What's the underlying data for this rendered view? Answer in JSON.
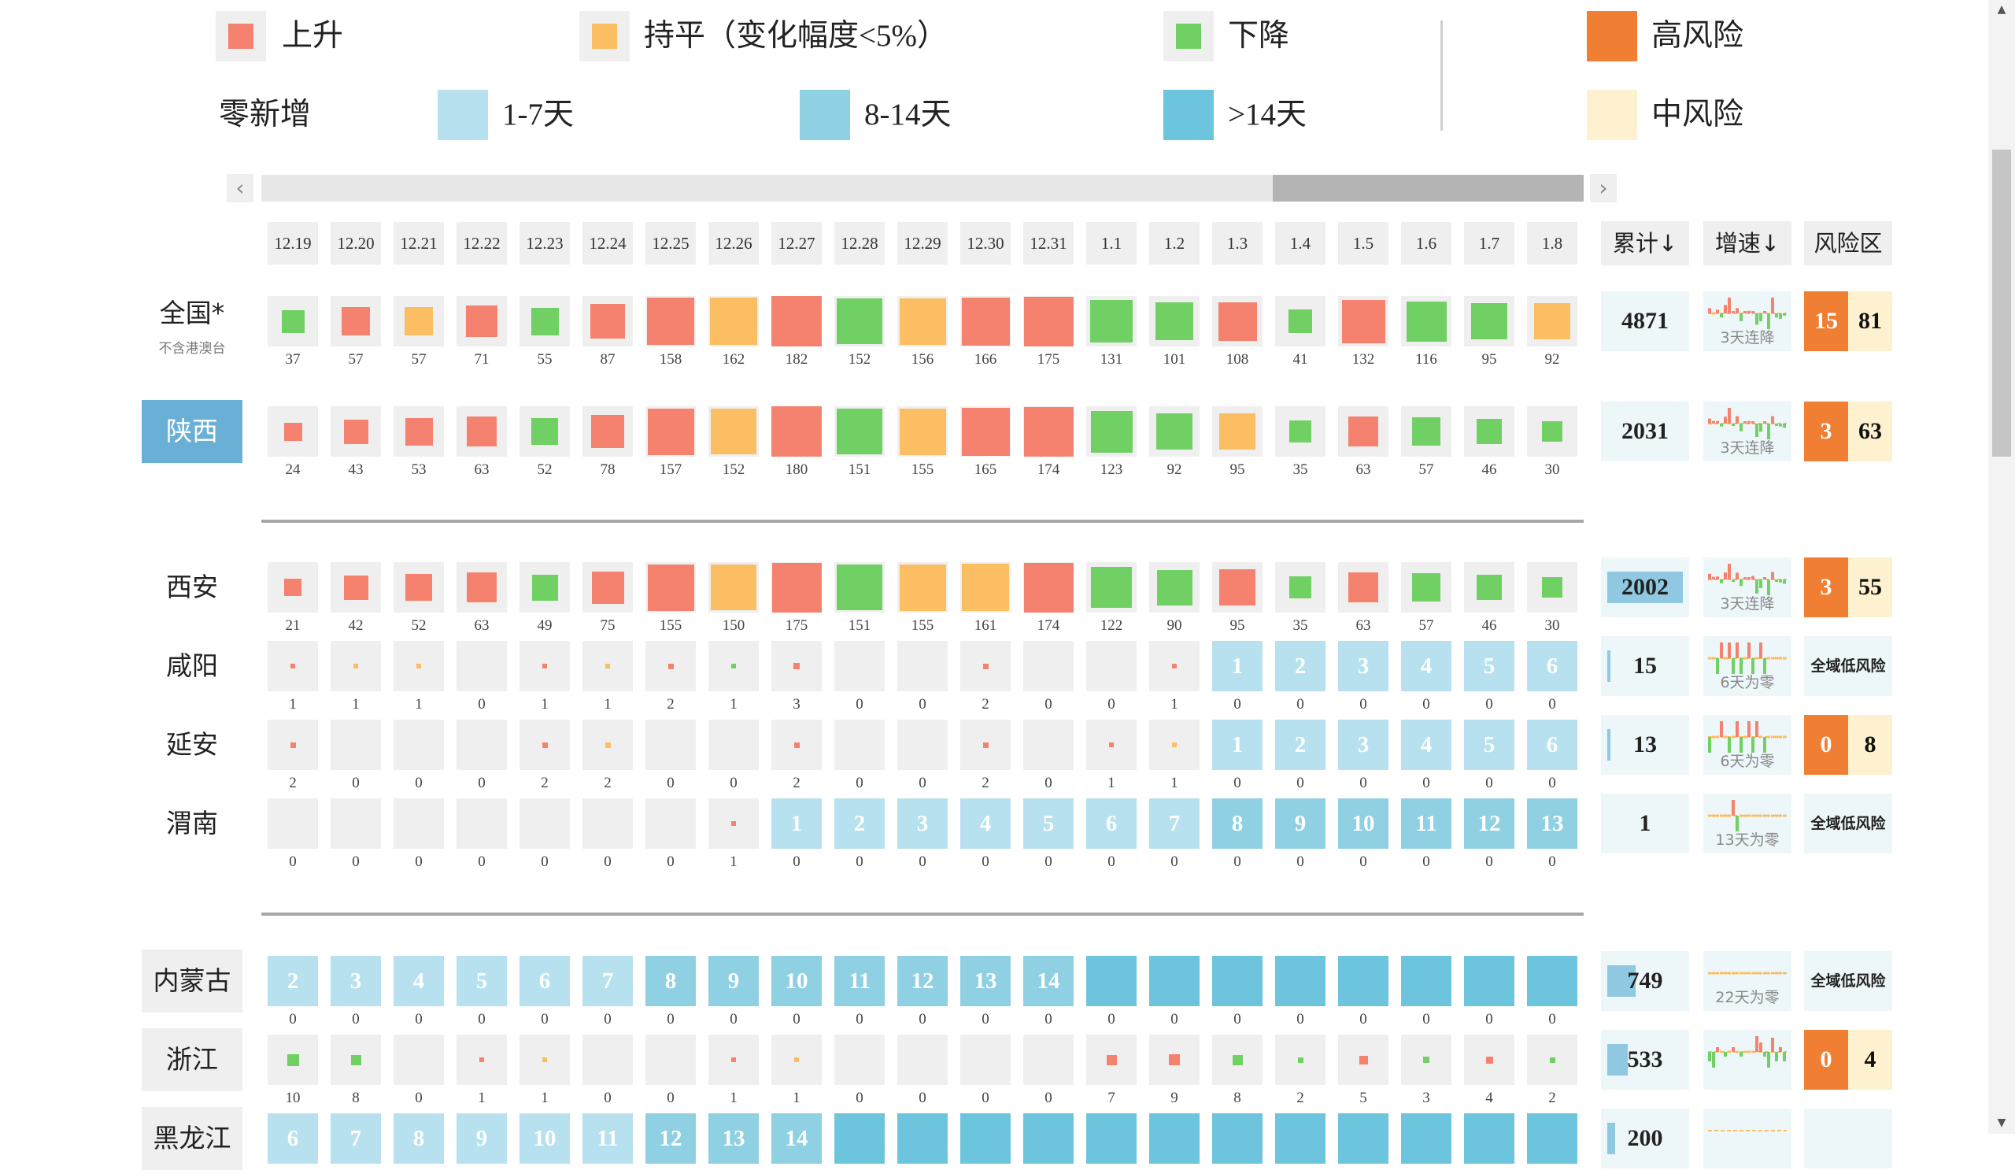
{
  "legend": {
    "rise": {
      "label": "上升",
      "color": "#f4826e"
    },
    "flat": {
      "label": "持平（变化幅度<5%）",
      "color": "#fbbe63"
    },
    "fall": {
      "label": "下降",
      "color": "#70d063"
    },
    "zero_label": "零新增",
    "d1_7": {
      "label": "1-7天",
      "color": "#b7e1ee"
    },
    "d8_14": {
      "label": "8-14天",
      "color": "#8fd0e2"
    },
    "d14": {
      "label": ">14天",
      "color": "#6cc5dc"
    },
    "high_risk": {
      "label": "高风险",
      "color": "#f07e33"
    },
    "mid_risk": {
      "label": "中风险",
      "color": "#fdf1cf"
    }
  },
  "table": {
    "dates": [
      "12.19",
      "12.20",
      "12.21",
      "12.22",
      "12.23",
      "12.24",
      "12.25",
      "12.26",
      "12.27",
      "12.28",
      "12.29",
      "12.30",
      "12.31",
      "1.1",
      "1.2",
      "1.3",
      "1.4",
      "1.5",
      "1.6",
      "1.7",
      "1.8"
    ],
    "col_total": "累计↓",
    "col_speed": "增速↓",
    "col_risk": "风险区",
    "scroll_left_icon": "chevron-left-icon",
    "scroll_right_icon": "chevron-right-icon",
    "scroll_thumb_fraction": 0.235,
    "scroll_position_fraction": 1.0
  },
  "rows": [
    {
      "name": "全国*",
      "sub": "不含港澳台",
      "style": "plain",
      "cells": [
        "f",
        "r",
        "s",
        "r",
        "f",
        "r",
        "r",
        "s",
        "r",
        "f",
        "s",
        "r",
        "r",
        "f",
        "f",
        "r",
        "f",
        "r",
        "f",
        "f",
        "s"
      ],
      "values": [
        37,
        57,
        57,
        71,
        55,
        87,
        158,
        162,
        182,
        152,
        156,
        166,
        175,
        131,
        101,
        108,
        41,
        132,
        116,
        95,
        92
      ],
      "total": "4871",
      "total_bar": 0,
      "trend_label": "3天连降",
      "spark": [
        37,
        57,
        57,
        71,
        55,
        87,
        158,
        162,
        182,
        152,
        156,
        166,
        175,
        131,
        101,
        108,
        41,
        132,
        116,
        95,
        92
      ],
      "risk_high": "15",
      "risk_mid": "81",
      "risk_low": ""
    },
    {
      "name": "陕西",
      "sub": "",
      "style": "highlight",
      "cells": [
        "r",
        "r",
        "r",
        "r",
        "f",
        "r",
        "r",
        "s",
        "r",
        "f",
        "s",
        "r",
        "r",
        "f",
        "f",
        "s",
        "f",
        "r",
        "f",
        "f",
        "f"
      ],
      "values": [
        24,
        43,
        53,
        63,
        52,
        78,
        157,
        152,
        180,
        151,
        155,
        165,
        174,
        123,
        92,
        95,
        35,
        63,
        57,
        46,
        30
      ],
      "total": "2031",
      "total_bar": 0,
      "trend_label": "3天连降",
      "spark": [
        24,
        43,
        53,
        63,
        52,
        78,
        157,
        152,
        180,
        151,
        155,
        165,
        174,
        123,
        92,
        95,
        35,
        63,
        57,
        46,
        30
      ],
      "risk_high": "3",
      "risk_mid": "63",
      "risk_low": ""
    },
    {
      "name": "西安",
      "sub": "",
      "style": "plain",
      "cells": [
        "r",
        "r",
        "r",
        "r",
        "f",
        "r",
        "r",
        "s",
        "r",
        "f",
        "s",
        "s",
        "r",
        "f",
        "f",
        "r",
        "f",
        "r",
        "f",
        "f",
        "f"
      ],
      "values": [
        21,
        42,
        52,
        63,
        49,
        75,
        155,
        150,
        175,
        151,
        155,
        161,
        174,
        122,
        90,
        95,
        35,
        63,
        57,
        46,
        30
      ],
      "total": "2002",
      "total_bar": 1.0,
      "trend_label": "3天连降",
      "spark": [
        21,
        42,
        52,
        63,
        49,
        75,
        155,
        150,
        175,
        151,
        155,
        161,
        174,
        122,
        90,
        95,
        35,
        63,
        57,
        46,
        30
      ],
      "risk_high": "3",
      "risk_mid": "55",
      "risk_low": ""
    },
    {
      "name": "咸阳",
      "sub": "",
      "style": "plain",
      "cells": [
        "r",
        "s",
        "s",
        "e",
        "r",
        "s",
        "r",
        "f",
        "r",
        "e",
        "e",
        "r",
        "e",
        "e",
        "r",
        "z1",
        "z1",
        "z1",
        "z1",
        "z1",
        "z1"
      ],
      "zero_days": [
        "",
        "",
        "",
        "",
        "",
        "",
        "",
        "",
        "",
        "",
        "",
        "",
        "",
        "",
        "",
        "1",
        "2",
        "3",
        "4",
        "5",
        "6"
      ],
      "values": [
        1,
        1,
        1,
        0,
        1,
        1,
        2,
        1,
        3,
        0,
        0,
        2,
        0,
        0,
        1,
        0,
        0,
        0,
        0,
        0,
        0
      ],
      "total": "15",
      "total_bar": 0.0075,
      "trend_label": "6天为零",
      "spark": [
        1,
        1,
        1,
        0,
        1,
        1,
        2,
        1,
        3,
        0,
        0,
        2,
        0,
        0,
        1,
        0,
        0,
        0,
        0,
        0,
        0
      ],
      "risk_high": "",
      "risk_mid": "",
      "risk_low": "全域低风险"
    },
    {
      "name": "延安",
      "sub": "",
      "style": "plain",
      "cells": [
        "r",
        "e",
        "e",
        "e",
        "r",
        "s",
        "e",
        "e",
        "r",
        "e",
        "e",
        "r",
        "e",
        "r",
        "s",
        "z1",
        "z1",
        "z1",
        "z1",
        "z1",
        "z1"
      ],
      "zero_days": [
        "",
        "",
        "",
        "",
        "",
        "",
        "",
        "",
        "",
        "",
        "",
        "",
        "",
        "",
        "",
        "1",
        "2",
        "3",
        "4",
        "5",
        "6"
      ],
      "values": [
        2,
        0,
        0,
        0,
        2,
        2,
        0,
        0,
        2,
        0,
        0,
        2,
        0,
        1,
        1,
        0,
        0,
        0,
        0,
        0,
        0
      ],
      "total": "13",
      "total_bar": 0.0065,
      "trend_label": "6天为零",
      "spark": [
        2,
        0,
        0,
        0,
        2,
        2,
        0,
        0,
        2,
        0,
        0,
        2,
        0,
        1,
        1,
        0,
        0,
        0,
        0,
        0,
        0
      ],
      "risk_high": "0",
      "risk_mid": "8",
      "risk_low": ""
    },
    {
      "name": "渭南",
      "sub": "",
      "style": "plain",
      "cells": [
        "e",
        "e",
        "e",
        "e",
        "e",
        "e",
        "e",
        "r",
        "z1",
        "z1",
        "z1",
        "z1",
        "z1",
        "z1",
        "z1",
        "z2",
        "z2",
        "z2",
        "z2",
        "z2",
        "z2"
      ],
      "zero_days": [
        "",
        "",
        "",
        "",
        "",
        "",
        "",
        "",
        "1",
        "2",
        "3",
        "4",
        "5",
        "6",
        "7",
        "8",
        "9",
        "10",
        "11",
        "12",
        "13"
      ],
      "values": [
        0,
        0,
        0,
        0,
        0,
        0,
        0,
        1,
        0,
        0,
        0,
        0,
        0,
        0,
        0,
        0,
        0,
        0,
        0,
        0,
        0
      ],
      "total": "1",
      "total_bar": 0,
      "trend_label": "13天为零",
      "spark": [
        0,
        0,
        0,
        0,
        0,
        0,
        0,
        1,
        0,
        0,
        0,
        0,
        0,
        0,
        0,
        0,
        0,
        0,
        0,
        0,
        0
      ],
      "risk_high": "",
      "risk_mid": "",
      "risk_low": "全域低风险"
    },
    {
      "name": "内蒙古",
      "sub": "",
      "style": "gray",
      "cells": [
        "z1",
        "z1",
        "z1",
        "z1",
        "z1",
        "z1",
        "z2",
        "z2",
        "z2",
        "z2",
        "z2",
        "z2",
        "z2",
        "z3",
        "z3",
        "z3",
        "z3",
        "z3",
        "z3",
        "z3",
        "z3"
      ],
      "zero_days": [
        "2",
        "3",
        "4",
        "5",
        "6",
        "7",
        "8",
        "9",
        "10",
        "11",
        "12",
        "13",
        "14",
        "",
        "",
        "",
        "",
        "",
        "",
        "",
        ""
      ],
      "values": [
        0,
        0,
        0,
        0,
        0,
        0,
        0,
        0,
        0,
        0,
        0,
        0,
        0,
        0,
        0,
        0,
        0,
        0,
        0,
        0,
        0
      ],
      "total": "749",
      "total_bar": 0.37,
      "trend_label": "22天为零",
      "spark": [
        0,
        0,
        0,
        0,
        0,
        0,
        0,
        0,
        0,
        0,
        0,
        0,
        0,
        0,
        0,
        0,
        0,
        0,
        0,
        0,
        0
      ],
      "risk_high": "",
      "risk_mid": "",
      "risk_low": "全域低风险"
    },
    {
      "name": "浙江",
      "sub": "",
      "style": "gray",
      "cells": [
        "f",
        "f",
        "e",
        "r",
        "s",
        "e",
        "e",
        "r",
        "s",
        "e",
        "e",
        "e",
        "e",
        "r",
        "r",
        "f",
        "f",
        "r",
        "f",
        "r",
        "f"
      ],
      "values": [
        10,
        8,
        0,
        1,
        1,
        0,
        0,
        1,
        1,
        0,
        0,
        0,
        0,
        7,
        9,
        8,
        2,
        5,
        3,
        4,
        2
      ],
      "total": "533",
      "total_bar": 0.27,
      "trend_label": "",
      "spark": [
        10,
        8,
        0,
        1,
        1,
        0,
        0,
        1,
        1,
        0,
        0,
        0,
        0,
        7,
        9,
        8,
        2,
        5,
        3,
        4,
        2
      ],
      "risk_high": "0",
      "risk_mid": "4",
      "risk_low": ""
    },
    {
      "name": "黑龙江",
      "sub": "",
      "style": "gray",
      "cells": [
        "z1",
        "z1",
        "z1",
        "z1",
        "z1",
        "z1",
        "z2",
        "z2",
        "z2",
        "z3",
        "z3",
        "z3",
        "z3",
        "z3",
        "z3",
        "z3",
        "z3",
        "z3",
        "z3",
        "z3",
        "z3"
      ],
      "zero_days": [
        "6",
        "7",
        "8",
        "9",
        "10",
        "11",
        "12",
        "13",
        "14",
        "",
        "",
        "",
        "",
        "",
        "",
        "",
        "",
        "",
        "",
        "",
        ""
      ],
      "values": [],
      "total": "200",
      "total_bar": 0.1,
      "trend_label": "",
      "spark": [],
      "risk_high": "",
      "risk_mid": "",
      "risk_low": ""
    }
  ]
}
